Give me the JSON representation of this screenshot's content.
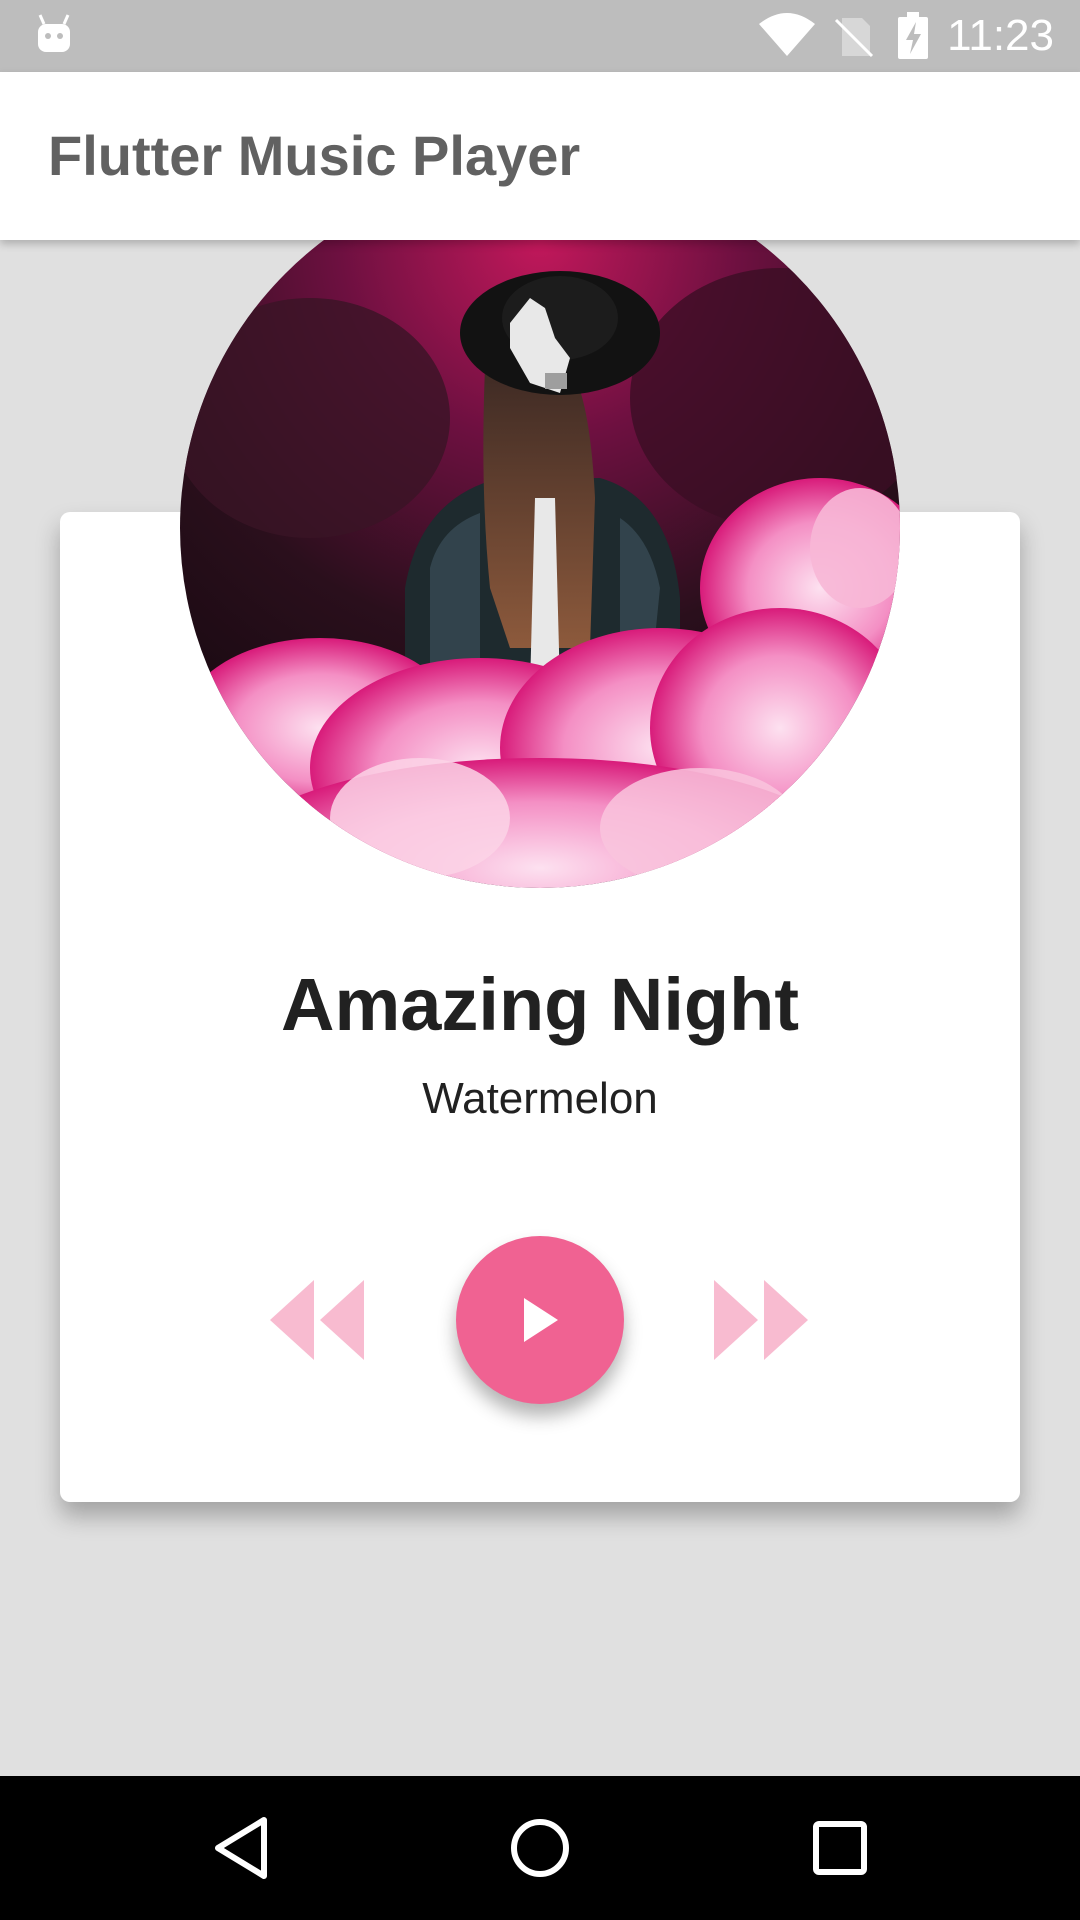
{
  "status_bar": {
    "time": "11:23",
    "icons": [
      "android-icon",
      "wifi-icon",
      "no-sim-icon",
      "battery-charging-icon"
    ]
  },
  "app_bar": {
    "title": "Flutter Music Player"
  },
  "player": {
    "album_art": "album-art-image",
    "song_title": "Amazing Night",
    "artist": "Watermelon",
    "controls": {
      "rewind_icon": "rewind-icon",
      "play_icon": "play-icon",
      "fast_forward_icon": "fast-forward-icon"
    }
  },
  "nav_bar": {
    "icons": [
      "back-icon",
      "home-icon",
      "recents-icon"
    ]
  },
  "colors": {
    "accent": "#f06292",
    "control_light": "#f8bbd0",
    "status_bar": "#bdbdbd",
    "background": "#e0e0e0"
  }
}
